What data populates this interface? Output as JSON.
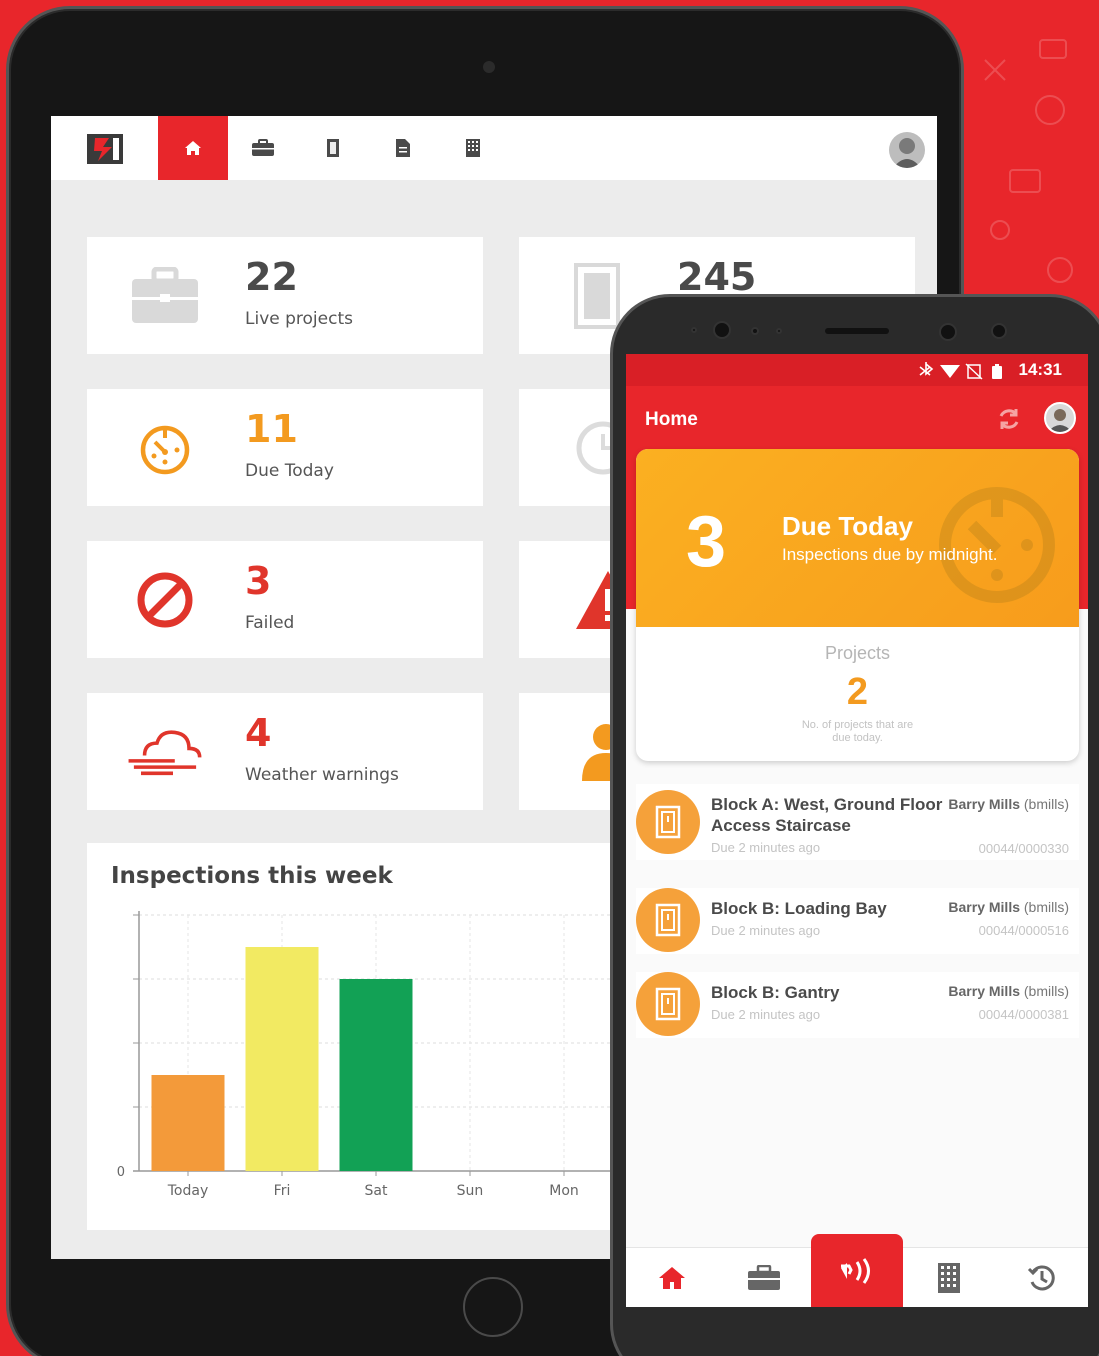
{
  "tablet": {
    "nav": {
      "items": [
        {
          "name": "home-icon",
          "active": true
        },
        {
          "name": "briefcase-icon",
          "active": false
        },
        {
          "name": "door-icon",
          "active": false
        },
        {
          "name": "document-icon",
          "active": false
        },
        {
          "name": "building-icon",
          "active": false
        }
      ]
    },
    "stats": [
      {
        "value": "22",
        "label": "Live projects",
        "icon": "briefcase-icon",
        "color": "#4a4a4a"
      },
      {
        "value": "11",
        "label": "Due Today",
        "icon": "timer-icon",
        "color": "#f39a1f"
      },
      {
        "value": "3",
        "label": "Failed",
        "icon": "ban-icon",
        "color": "#e0352b"
      },
      {
        "value": "4",
        "label": "Weather warnings",
        "icon": "cloud-wind-icon",
        "color": "#e0352b"
      }
    ],
    "stats_right": [
      {
        "value": "245",
        "icon": "door-icon"
      },
      {
        "icon": "clock-icon"
      },
      {
        "icon": "warning-icon"
      },
      {
        "icon": "user-icon"
      }
    ],
    "chart_title": "Inspections this week"
  },
  "chart_data": {
    "type": "bar",
    "title": "Inspections this week",
    "categories": [
      "Today",
      "Fri",
      "Sat",
      "Sun",
      "Mon"
    ],
    "values": [
      3,
      7,
      6,
      0,
      0
    ],
    "colors": [
      "#f39a3a",
      "#f2ea62",
      "#12a155",
      "#12a155",
      "#12a155"
    ],
    "ylim": [
      0,
      8
    ],
    "y_tick_labels": [
      "0"
    ],
    "grid": true
  },
  "phone": {
    "status_time": "14:31",
    "title": "Home",
    "due_card": {
      "count": "3",
      "title": "Due Today",
      "subtitle": "Inspections due by midnight.",
      "projects_label": "Projects",
      "projects_count": "2",
      "projects_desc_1": "No. of projects that are",
      "projects_desc_2": "due today."
    },
    "inspections": [
      {
        "name_1": "Block A: West, Ground Floor",
        "name_2": "Access Staircase",
        "due": "Due 2 minutes ago",
        "user_name": "Barry Mills",
        "user_handle": "(bmills)",
        "id": "00044/0000330"
      },
      {
        "name_1": "Block B: Loading Bay",
        "name_2": "",
        "due": "Due 2 minutes ago",
        "user_name": "Barry Mills",
        "user_handle": "(bmills)",
        "id": "00044/0000516"
      },
      {
        "name_1": "Block B: Gantry",
        "name_2": "",
        "due": "Due 2 minutes ago",
        "user_name": "Barry Mills",
        "user_handle": "(bmills)",
        "id": "00044/0000381"
      }
    ],
    "bottom_nav": [
      "home-icon",
      "briefcase-icon",
      "nfc-icon",
      "building-icon",
      "history-icon"
    ]
  }
}
